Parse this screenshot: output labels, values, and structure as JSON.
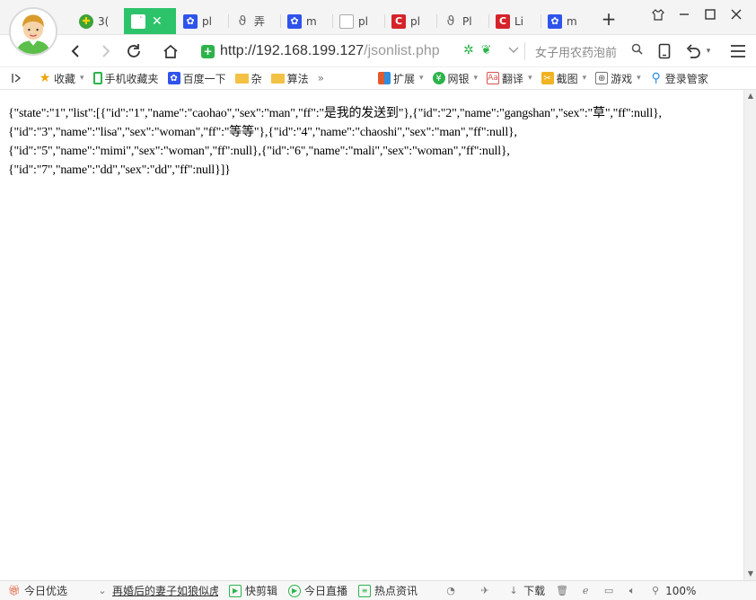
{
  "tabs": [
    {
      "label": "3(",
      "icon": "360-icon",
      "active": false
    },
    {
      "label": "",
      "icon": "document-icon",
      "active": true,
      "close": "✕"
    },
    {
      "label": "pl",
      "icon": "paw-icon",
      "active": false
    },
    {
      "label": "弄",
      "icon": "phi-icon",
      "active": false
    },
    {
      "label": "m",
      "icon": "paw-icon",
      "active": false
    },
    {
      "label": "pl",
      "icon": "document-icon",
      "active": false
    },
    {
      "label": "pl",
      "icon": "c-icon",
      "active": false
    },
    {
      "label": "Pl",
      "icon": "phi-icon",
      "active": false
    },
    {
      "label": "Li",
      "icon": "c-icon",
      "active": false
    },
    {
      "label": "m",
      "icon": "paw-icon",
      "active": false
    }
  ],
  "new_tab_label": "+",
  "address": {
    "host": "http://192.168.199.127",
    "path": "/jsonlist.php"
  },
  "search": {
    "text": "女子用农药泡前"
  },
  "bookmarks": [
    {
      "label": "收藏",
      "icon": "star-icon",
      "dropdown": true
    },
    {
      "label": "手机收藏夹",
      "icon": "phone-icon",
      "dropdown": false
    },
    {
      "label": "百度一下",
      "icon": "paw-icon",
      "dropdown": false
    },
    {
      "label": "杂",
      "icon": "folder-icon",
      "dropdown": false
    },
    {
      "label": "算法",
      "icon": "folder-icon",
      "dropdown": false
    }
  ],
  "bookmarks_more": "»",
  "bookmark_tools": [
    {
      "label": "扩展",
      "icon": "grid-icon"
    },
    {
      "label": "网银",
      "icon": "yen-icon"
    },
    {
      "label": "翻译",
      "icon": "translate-icon"
    },
    {
      "label": "截图",
      "icon": "scissors-icon"
    },
    {
      "label": "游戏",
      "icon": "gamepad-icon"
    }
  ],
  "login_manager": "登录管家",
  "page": {
    "line1": "{\"state\":\"1\",\"list\":[{\"id\":\"1\",\"name\":\"caohao\",\"sex\":\"man\",\"ff\":\"是我的发送到\"},{\"id\":\"2\",\"name\":\"gangshan\",\"sex\":\"草\",\"ff\":null},",
    "line2": "{\"id\":\"3\",\"name\":\"lisa\",\"sex\":\"woman\",\"ff\":\"等等\"},{\"id\":\"4\",\"name\":\"chaoshi\",\"sex\":\"man\",\"ff\":null},",
    "line3": "{\"id\":\"5\",\"name\":\"mimi\",\"sex\":\"woman\",\"ff\":null},{\"id\":\"6\",\"name\":\"mali\",\"sex\":\"woman\",\"ff\":null},",
    "line4": "{\"id\":\"7\",\"name\":\"dd\",\"sex\":\"dd\",\"ff\":null}]}"
  },
  "status": {
    "today_pick": "今日优选",
    "news": "再婚后的妻子如狼似虎",
    "quick_cut": "快剪辑",
    "live": "今日直播",
    "hot_news": "热点资讯",
    "download": "下载",
    "zoom": "100%"
  },
  "colors": {
    "active_tab": "#2cc36a",
    "secure_green": "#2cb34a",
    "url_gray": "#9a9a9a"
  }
}
